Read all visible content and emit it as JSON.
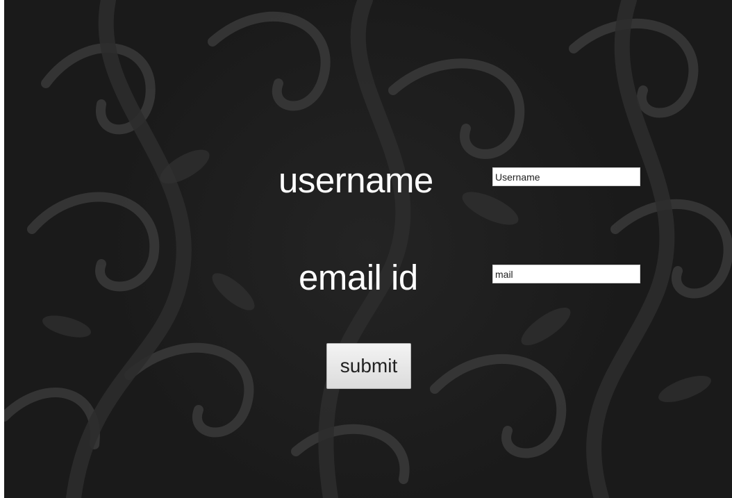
{
  "form": {
    "username_label": "username",
    "username_value": "Username",
    "email_label": "email id",
    "email_value": "mail",
    "submit_label": "submit"
  },
  "colors": {
    "background": "#1a1a1a",
    "pattern": "#3a3a3a",
    "label_text": "#ffffff",
    "input_background": "#ffffff",
    "button_background": "#e6e6e6"
  },
  "icons": {
    "background_pattern": "damask-swirl-pattern"
  }
}
